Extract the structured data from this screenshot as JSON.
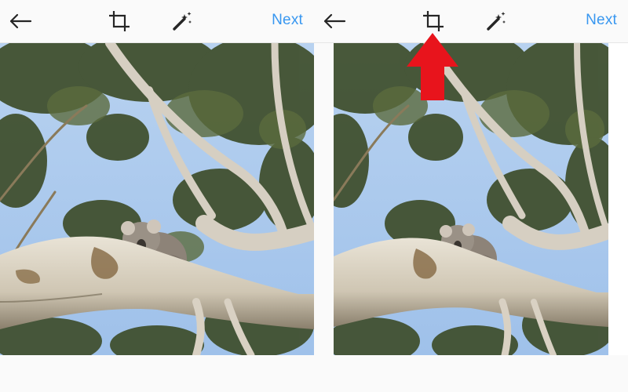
{
  "panels": [
    {
      "toolbar": {
        "back_icon": "arrow-left-icon",
        "crop_icon": "crop-icon",
        "magic_icon": "magic-wand-icon",
        "next_label": "Next"
      },
      "photo": "koala-in-eucalyptus-tree"
    },
    {
      "toolbar": {
        "back_icon": "arrow-left-icon",
        "crop_icon": "crop-icon",
        "magic_icon": "magic-wand-icon",
        "next_label": "Next"
      },
      "photo": "koala-in-eucalyptus-tree-cropped",
      "annotation": {
        "icon": "red-up-arrow-icon",
        "color": "#e8141c"
      }
    }
  ],
  "colors": {
    "accent": "#3897f0",
    "icon": "#262626",
    "sky": "#a9c8ec",
    "foliage": "#3e4d2a",
    "bark": "#d8d0c0"
  }
}
